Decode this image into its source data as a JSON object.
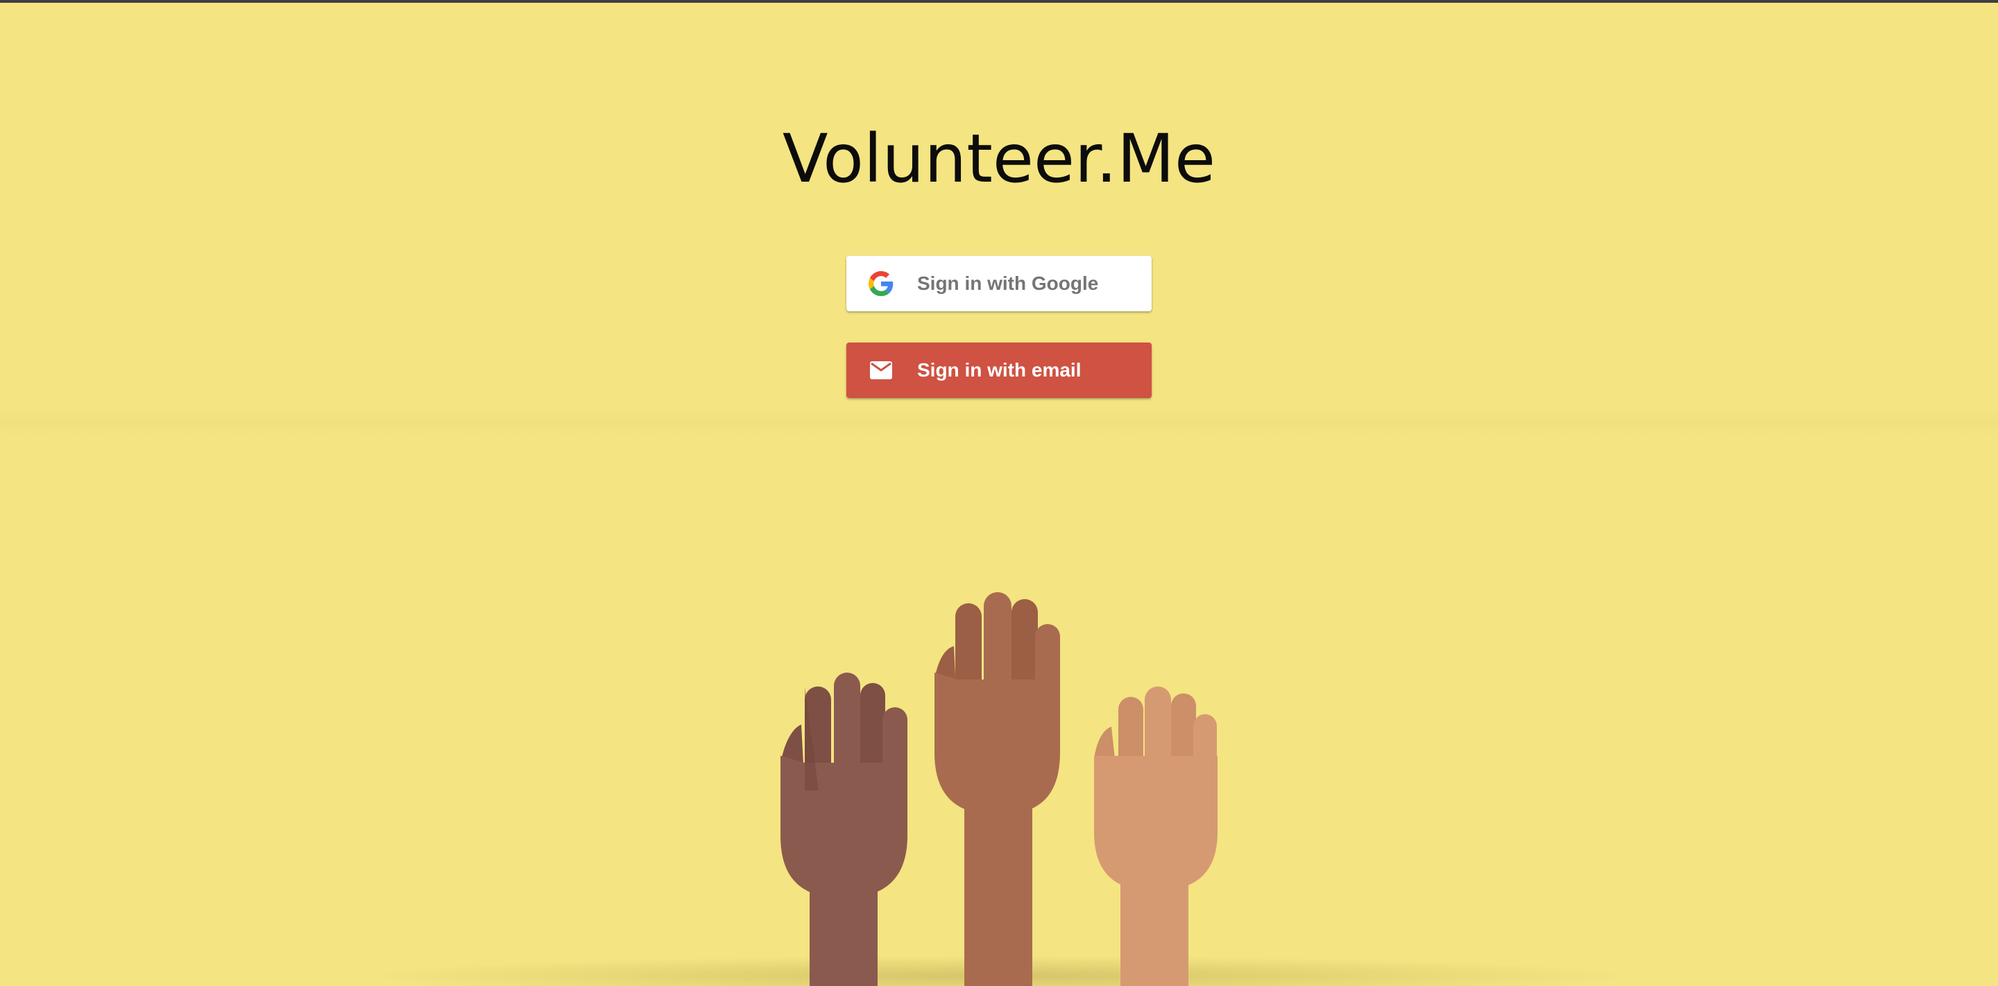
{
  "app": {
    "title": "Volunteer.Me"
  },
  "auth": {
    "google_label": "Sign in with Google",
    "email_label": "Sign in with email",
    "google_icon": "google-g-icon",
    "email_icon": "envelope-icon"
  },
  "colors": {
    "background": "#f4e482",
    "email_button": "#cf5242",
    "google_button": "#ffffff",
    "hand_dark": "#8b5a4e",
    "hand_medium": "#a96b4f",
    "hand_light": "#d69a72"
  }
}
